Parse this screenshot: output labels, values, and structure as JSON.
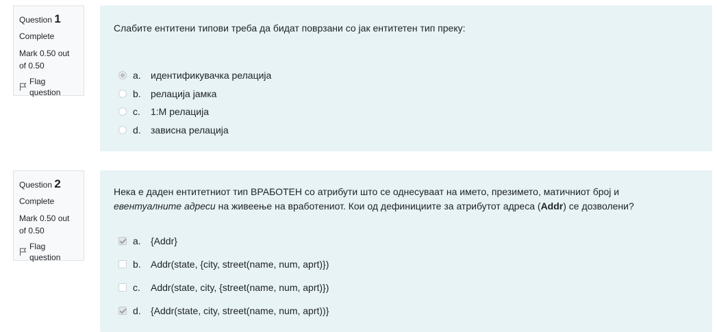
{
  "questions": [
    {
      "label": "Question",
      "number": "1",
      "state": "Complete",
      "grade": "Mark 0.50 out of 0.50",
      "flag": "Flag question",
      "text": "Слабите ентитени типови треба да бидат поврзани со јак ентитетен тип преку:",
      "type": "radio",
      "options": [
        {
          "letter": "a.",
          "text": "идентификувачка релација",
          "checked": true
        },
        {
          "letter": "b.",
          "text": "релација јамка",
          "checked": false
        },
        {
          "letter": "c.",
          "text": "1:M релација",
          "checked": false
        },
        {
          "letter": "d.",
          "text": "зависна релација",
          "checked": false
        }
      ]
    },
    {
      "label": "Question",
      "number": "2",
      "state": "Complete",
      "grade": "Mark 0.50 out of 0.50",
      "flag": "Flag question",
      "text_part1": "Нека е даден ентитетниот тип ВРАБОТЕН со атрибути што се однесуваат на името, презимето, матичниот број и",
      "text_italic": "евентуалните адреси",
      "text_part2": " на живеење на вработениот. Кои од дефинициите за атрибутот адреса (",
      "text_bold": "Addr",
      "text_part3": ") се дозволени?",
      "type": "checkbox",
      "options": [
        {
          "letter": "a.",
          "text": "{Addr}",
          "checked": true
        },
        {
          "letter": "b.",
          "text": "Addr(state, {city, street(name, num, aprt)})",
          "checked": false
        },
        {
          "letter": "c.",
          "text": "Addr(state, city, {street(name, num, aprt)})",
          "checked": false
        },
        {
          "letter": "d.",
          "text": "{Addr(state, city, street(name, num, aprt))}",
          "checked": true
        }
      ]
    }
  ]
}
